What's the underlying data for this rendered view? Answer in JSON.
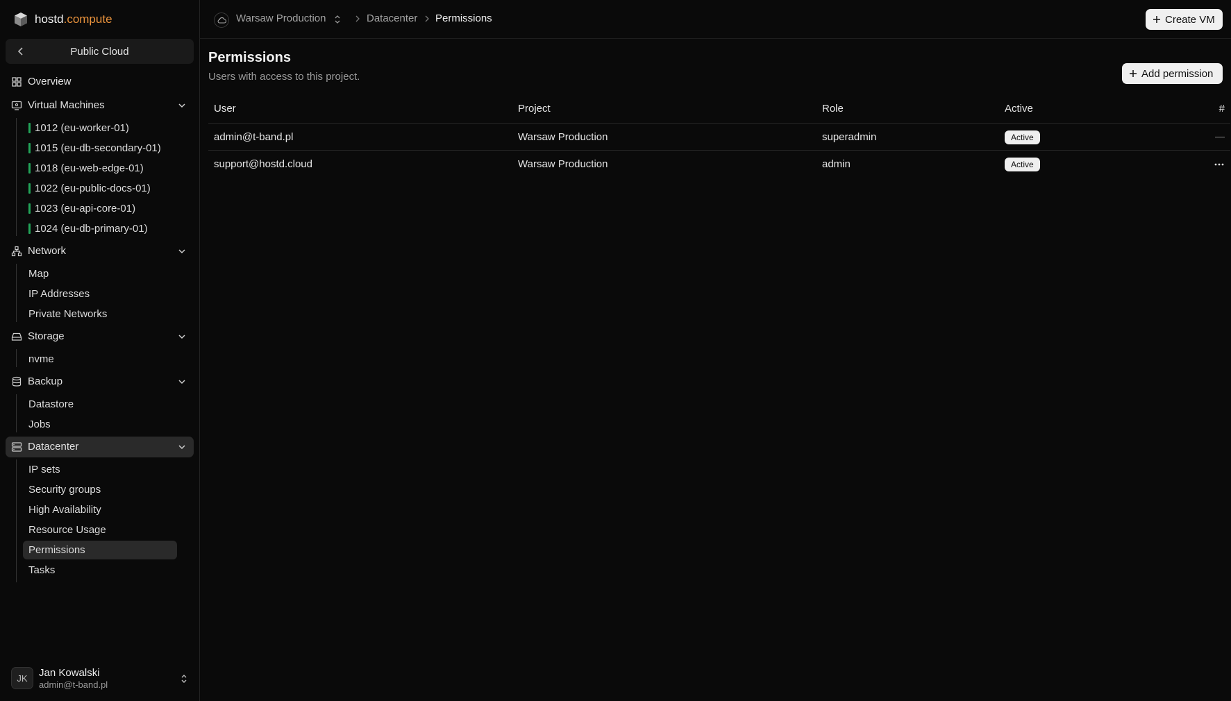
{
  "logo": {
    "brand": "hostd",
    "accent": ".compute"
  },
  "sidebar": {
    "cloud_switch": "Public Cloud",
    "overview": "Overview",
    "vms": {
      "label": "Virtual Machines",
      "items": [
        "1012 (eu-worker-01)",
        "1015 (eu-db-secondary-01)",
        "1018 (eu-web-edge-01)",
        "1022 (eu-public-docs-01)",
        "1023 (eu-api-core-01)",
        "1024 (eu-db-primary-01)"
      ]
    },
    "network": {
      "label": "Network",
      "items": [
        "Map",
        "IP Addresses",
        "Private Networks"
      ]
    },
    "storage": {
      "label": "Storage",
      "items": [
        "nvme"
      ]
    },
    "backup": {
      "label": "Backup",
      "items": [
        "Datastore",
        "Jobs"
      ]
    },
    "datacenter": {
      "label": "Datacenter",
      "items": [
        "IP sets",
        "Security groups",
        "High Availability",
        "Resource Usage",
        "Permissions",
        "Tasks"
      ]
    }
  },
  "user": {
    "initials": "JK",
    "name": "Jan Kowalski",
    "email": "admin@t-band.pl"
  },
  "topbar": {
    "project": "Warsaw Production",
    "crumbs": [
      "Datacenter",
      "Permissions"
    ],
    "create_vm": "Create VM"
  },
  "page": {
    "title": "Permissions",
    "subtitle": "Users with access to this project.",
    "add_button": "Add permission"
  },
  "table": {
    "headers": [
      "User",
      "Project",
      "Role",
      "Active",
      "#"
    ],
    "rows": [
      {
        "user": "admin@t-band.pl",
        "project": "Warsaw Production",
        "role": "superadmin",
        "active": "Active"
      },
      {
        "user": "support@hostd.cloud",
        "project": "Warsaw Production",
        "role": "admin",
        "active": "Active"
      }
    ]
  },
  "colors": {
    "background": "#0a0a0a",
    "accent": "#e8923c",
    "vm_status": "#22a559",
    "active_bg": "#2a2a2a"
  },
  "icons": [
    "cube-logo-icon",
    "chevron-left-icon",
    "grid-icon",
    "monitor-icon",
    "network-icon",
    "storage-icon",
    "database-icon",
    "server-icon",
    "chevron-down-icon",
    "chevron-updown-icon",
    "cloud-icon",
    "chevron-right-icon",
    "plus-icon",
    "more-icon"
  ]
}
